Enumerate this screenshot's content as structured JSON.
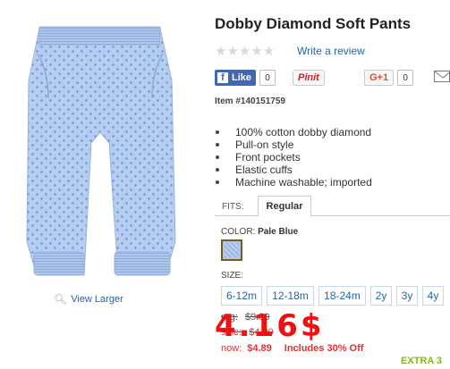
{
  "product": {
    "title": "Dobby Diamond Soft Pants",
    "write_review": "Write a review",
    "stars": "★★★★★",
    "item_number": "Item #140151759",
    "view_larger": "View Larger",
    "features": [
      "100% cotton dobby diamond",
      "Pull-on style",
      "Front pockets",
      "Elastic cuffs",
      "Machine washable; imported"
    ]
  },
  "social": {
    "facebook_label": "Like",
    "facebook_icon": "f",
    "facebook_count": "0",
    "pinterest_label": "Pinit",
    "gplus_label": "G+1",
    "gplus_count": "0"
  },
  "fits": {
    "label": "FITS:",
    "tab": "Regular"
  },
  "color": {
    "label": "COLOR:",
    "value": "Pale Blue"
  },
  "size": {
    "label": "SIZE:",
    "options": [
      "6-12m",
      "12-18m",
      "18-24m",
      "2y",
      "3y",
      "4y"
    ]
  },
  "price": {
    "reg_label": "reg:",
    "reg_value": "$9.80",
    "sale_label": "sale:",
    "sale_value": "$4.90",
    "now_label": "now:",
    "now_value": "$4.89",
    "includes": "Includes 30% Off",
    "overlay": "4.16$",
    "extra": "EXTRA 3"
  }
}
